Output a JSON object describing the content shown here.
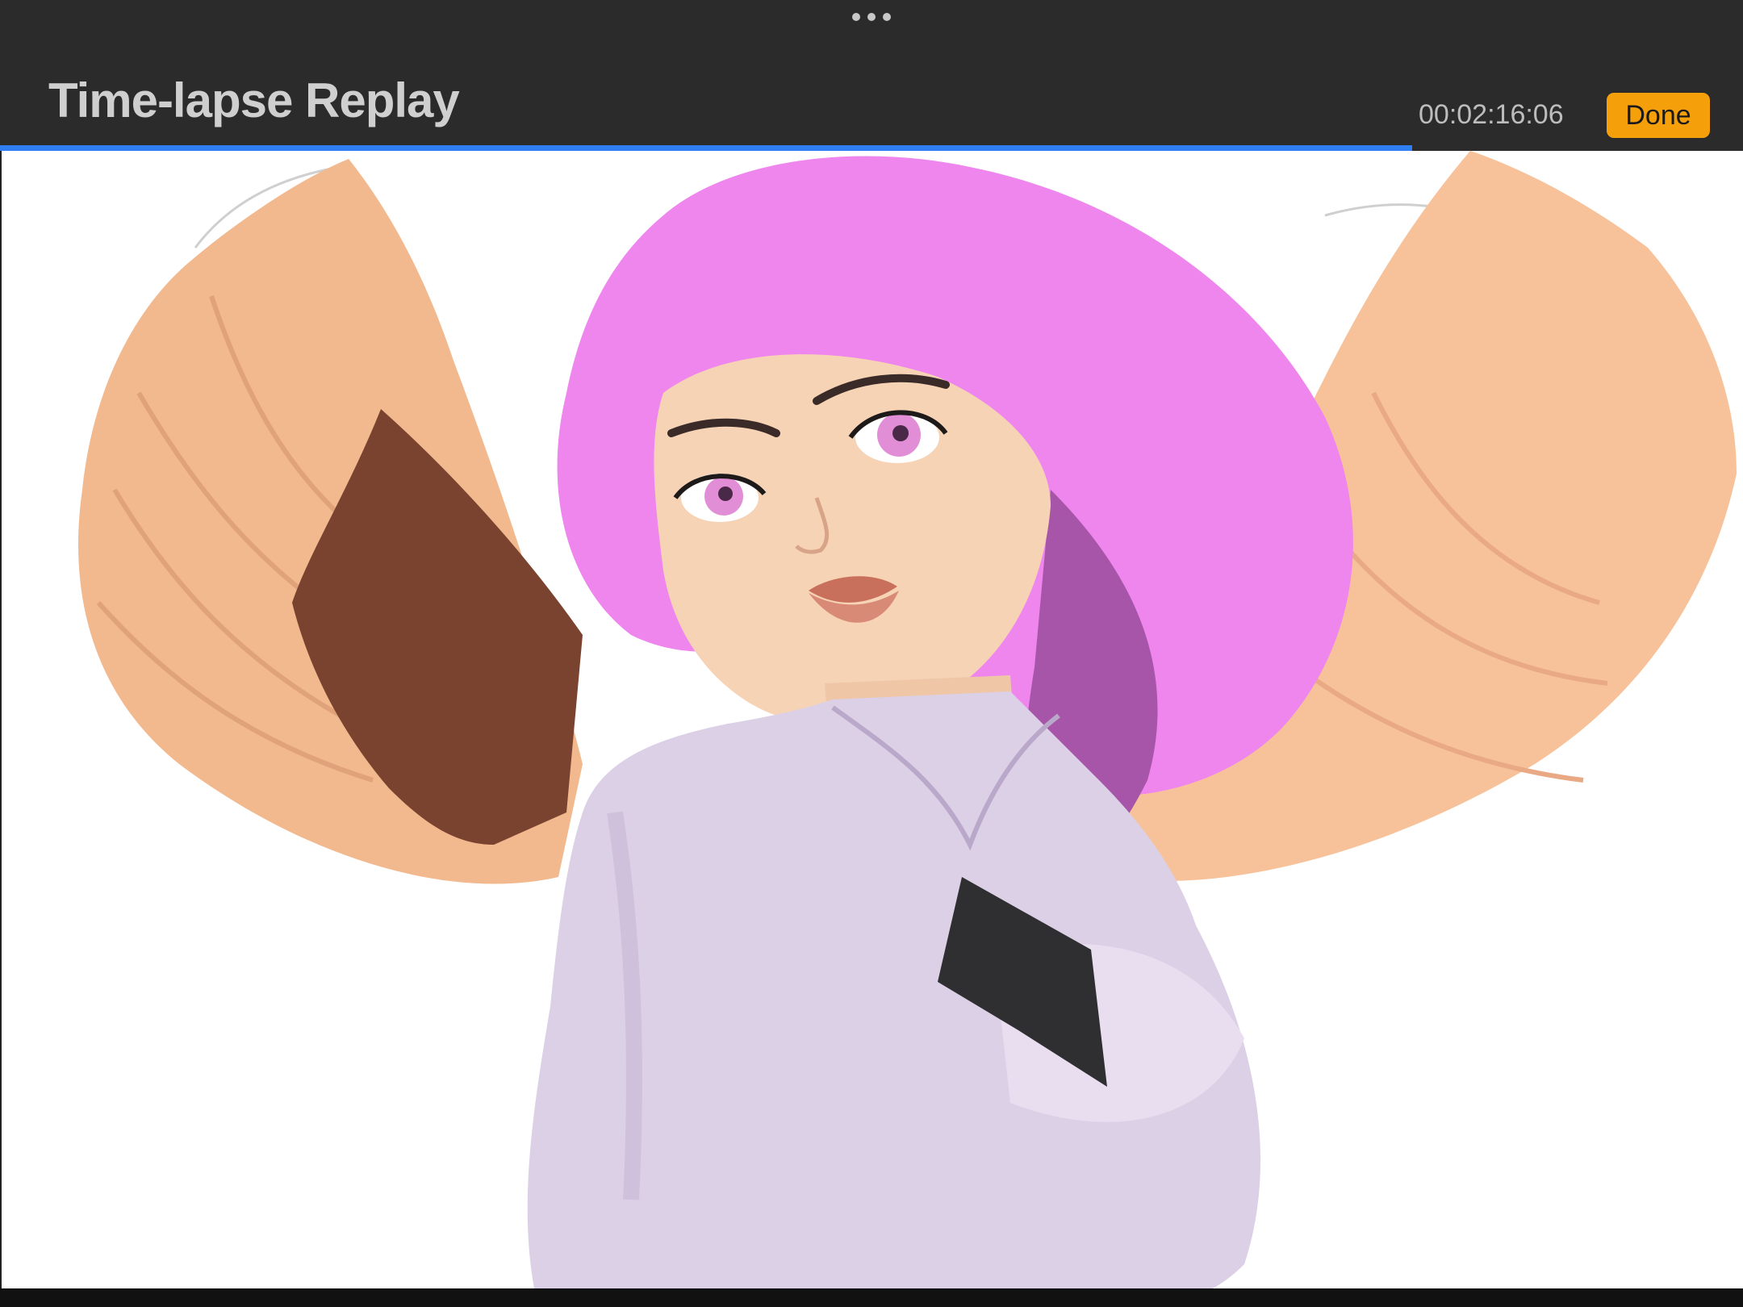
{
  "app": {
    "title": "Time-lapse Replay",
    "timecode": "00:02:16:06",
    "done_label": "Done",
    "accent_color": "#f5a00a",
    "progress_color": "#2f7ff2"
  },
  "playback": {
    "progress_percent": 81
  },
  "icons": {
    "grabber": "more-dots-icon"
  },
  "artwork": {
    "description_icon": "artwork-canvas"
  }
}
